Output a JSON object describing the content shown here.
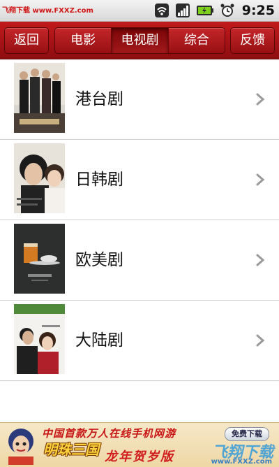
{
  "status_bar": {
    "watermark": "飞翔下载 www.FXXZ.com",
    "time": "9:25",
    "icons": [
      "wifi-icon",
      "signal-icon",
      "battery-icon",
      "alarm-icon"
    ]
  },
  "toolbar": {
    "back_label": "返回",
    "feedback_label": "反馈",
    "tabs": [
      {
        "label": "电影",
        "active": false
      },
      {
        "label": "电视剧",
        "active": true
      },
      {
        "label": "综合",
        "active": false
      }
    ],
    "accent_color": "#a8141a"
  },
  "list": {
    "items": [
      {
        "label": "港台剧",
        "thumb": "tv-poster-hk-taiwan"
      },
      {
        "label": "日韩剧",
        "thumb": "tv-poster-japan-korea"
      },
      {
        "label": "欧美剧",
        "thumb": "tv-poster-western"
      },
      {
        "label": "大陆剧",
        "thumb": "tv-poster-mainland"
      }
    ]
  },
  "ad_banner": {
    "headline": "中国首款万人在线手机网游",
    "game_logo": "明珠三国",
    "slogan": "龙年贺岁版",
    "button": "免费下载",
    "watermark": "飞翔下载",
    "watermark_url": "www.FXXZ.com"
  }
}
